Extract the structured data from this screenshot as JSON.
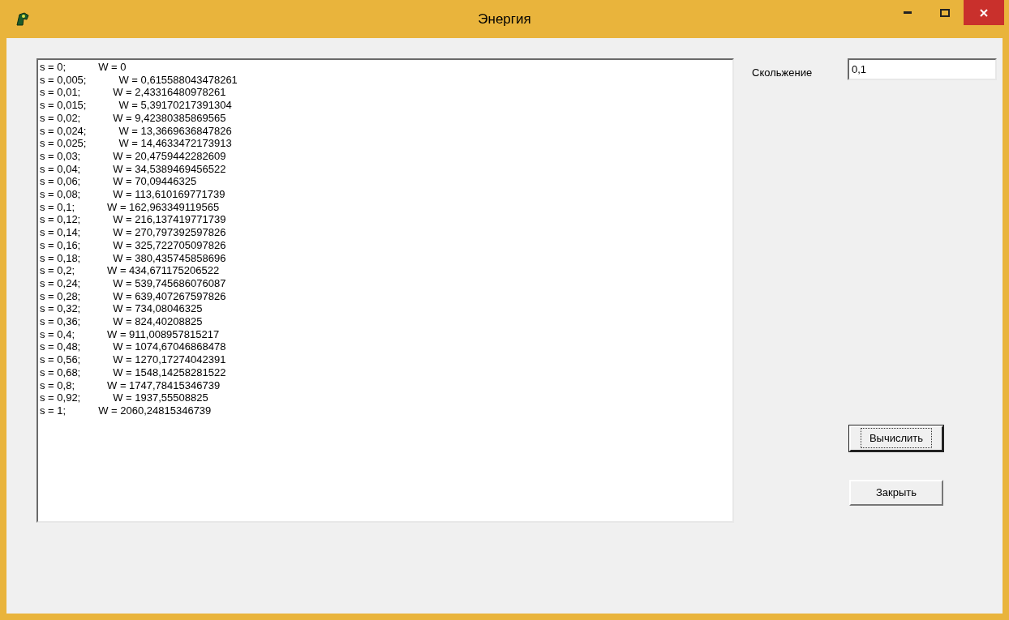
{
  "window": {
    "title": "Энергия"
  },
  "output_lines": [
    {
      "s": "s = 0;",
      "w": "W = 0"
    },
    {
      "s": "s = 0,005;",
      "w": "W = 0,615588043478261"
    },
    {
      "s": "s = 0,01;",
      "w": "W = 2,43316480978261"
    },
    {
      "s": "s = 0,015;",
      "w": "W = 5,39170217391304"
    },
    {
      "s": "s = 0,02;",
      "w": "W = 9,42380385869565"
    },
    {
      "s": "s = 0,024;",
      "w": "W = 13,3669636847826"
    },
    {
      "s": "s = 0,025;",
      "w": "W = 14,4633472173913"
    },
    {
      "s": "s = 0,03;",
      "w": "W = 20,4759442282609"
    },
    {
      "s": "s = 0,04;",
      "w": "W = 34,5389469456522"
    },
    {
      "s": "s = 0,06;",
      "w": "W = 70,09446325"
    },
    {
      "s": "s = 0,08;",
      "w": "W = 113,610169771739"
    },
    {
      "s": "s = 0,1;",
      "w": "W = 162,963349119565"
    },
    {
      "s": "s = 0,12;",
      "w": "W = 216,137419771739"
    },
    {
      "s": "s = 0,14;",
      "w": "W = 270,797392597826"
    },
    {
      "s": "s = 0,16;",
      "w": "W = 325,722705097826"
    },
    {
      "s": "s = 0,18;",
      "w": "W = 380,435745858696"
    },
    {
      "s": "s = 0,2;",
      "w": "W = 434,671175206522"
    },
    {
      "s": "s = 0,24;",
      "w": "W = 539,745686076087"
    },
    {
      "s": "s = 0,28;",
      "w": "W = 639,407267597826"
    },
    {
      "s": "s = 0,32;",
      "w": "W = 734,08046325"
    },
    {
      "s": "s = 0,36;",
      "w": "W = 824,40208825"
    },
    {
      "s": "s = 0,4;",
      "w": "W = 911,008957815217"
    },
    {
      "s": "s = 0,48;",
      "w": "W = 1074,67046868478"
    },
    {
      "s": "s = 0,56;",
      "w": "W = 1270,17274042391"
    },
    {
      "s": "s = 0,68;",
      "w": "W = 1548,14258281522"
    },
    {
      "s": "s = 0,8;",
      "w": "W = 1747,78415346739"
    },
    {
      "s": "s = 0,92;",
      "w": "W = 1937,55508825"
    },
    {
      "s": "s = 1;",
      "w": "W = 2060,24815346739"
    }
  ],
  "slip": {
    "label": "Скольжение",
    "value": "0,1"
  },
  "buttons": [
    {
      "label": "Вычислить",
      "focused": true
    },
    {
      "label": "Закрыть",
      "focused": false
    }
  ]
}
